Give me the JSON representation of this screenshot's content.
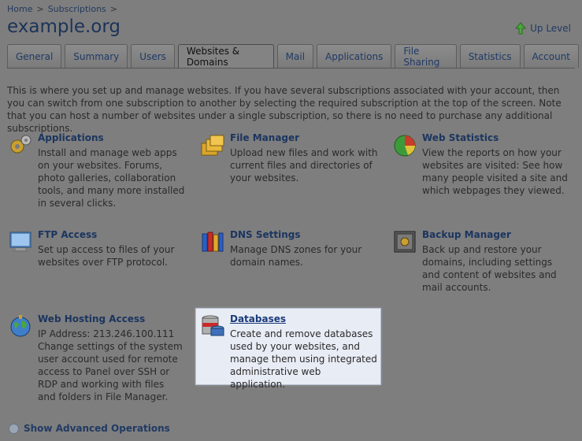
{
  "breadcrumb": {
    "home": "Home",
    "subscriptions": "Subscriptions",
    "sep": ">"
  },
  "page_title": "example.org",
  "up_level": "Up Level",
  "tabs": [
    {
      "label": "General"
    },
    {
      "label": "Summary"
    },
    {
      "label": "Users"
    },
    {
      "label": "Websites & Domains"
    },
    {
      "label": "Mail"
    },
    {
      "label": "Applications"
    },
    {
      "label": "File Sharing"
    },
    {
      "label": "Statistics"
    },
    {
      "label": "Account"
    }
  ],
  "intro": "This is where you set up and manage websites. If you have several subscriptions associated with your account, then you can switch from one subscription to another by selecting the required subscription at the top of the screen. Note that you can host a number of websites under a single subscription, so there is no need to purchase any additional subscriptions.",
  "tools": {
    "applications": {
      "title": "Applications",
      "desc": "Install and manage web apps on your websites. Forums, photo galleries, collaboration tools, and many more installed in several clicks."
    },
    "file_manager": {
      "title": "File Manager",
      "desc": "Upload new files and work with current files and directories of your websites."
    },
    "web_statistics": {
      "title": "Web Statistics",
      "desc": "View the reports on how your websites are visited: See how many people visited a site and which webpages they viewed."
    },
    "ftp_access": {
      "title": "FTP Access",
      "desc": "Set up access to files of your websites over FTP protocol."
    },
    "dns_settings": {
      "title": "DNS Settings",
      "desc": "Manage DNS zones for your domain names."
    },
    "backup_manager": {
      "title": "Backup Manager",
      "desc": "Back up and restore your domains, including settings and content of websites and mail accounts."
    },
    "web_hosting_access": {
      "title": "Web Hosting Access",
      "ip": "IP Address: 213.246.100.111",
      "desc": "Change settings of the system user account used for remote access to Panel over SSH or RDP and working with files and folders in File Manager."
    },
    "databases": {
      "title": "Databases",
      "desc": "Create and remove databases used by your websites, and manage them using integrated administrative web application."
    }
  },
  "advanced": "Show Advanced Operations"
}
